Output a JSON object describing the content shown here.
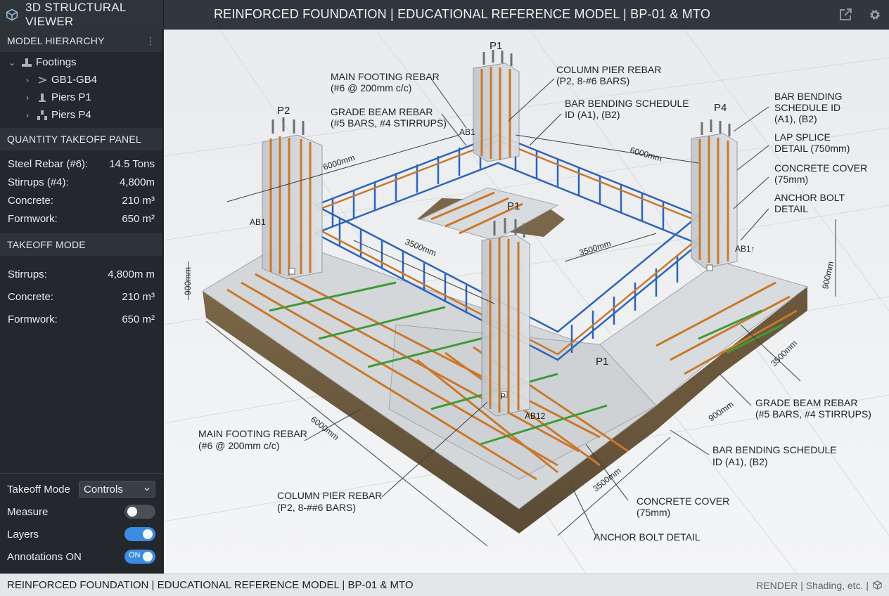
{
  "app": {
    "name": "3D STRUCTURAL VIEWER",
    "document_title": "REINFORCED FOUNDATION | EDUCATIONAL REFERENCE MODEL | BP-01 & MTO"
  },
  "hierarchy": {
    "header": "MODEL HIERARCHY",
    "items": [
      {
        "label": "Footings",
        "expanded": true
      },
      {
        "label": "GB1-GB4"
      },
      {
        "label": "Piers P1"
      },
      {
        "label": "Piers P4"
      }
    ]
  },
  "quantity_panel": {
    "header": "QUANTITY TAKEOFF PANEL",
    "rows": [
      {
        "label": "Steel Rebar (#6):",
        "value": "14.5 Tons"
      },
      {
        "label": "Stirrups (#4):",
        "value": "4,800m"
      },
      {
        "label": "Concrete:",
        "value": "210 m³"
      },
      {
        "label": "Formwork:",
        "value": "650 m²"
      }
    ]
  },
  "takeoff_mode": {
    "header": "TAKEOFF MODE",
    "rows": [
      {
        "label": "Stirrups:",
        "value": "4,800m m"
      },
      {
        "label": "Concrete:",
        "value": "210 m³"
      },
      {
        "label": "Formwork:",
        "value": "650 m²"
      }
    ]
  },
  "controls": {
    "takeoff_mode_label": "Takeoff Mode",
    "takeoff_mode_value": "Controls",
    "measure_label": "Measure",
    "measure_on": false,
    "layers_label": "Layers",
    "layers_on": true,
    "annotations_label": "Annotations ON",
    "annotations_on": true,
    "annotations_toggle_text": "ON"
  },
  "viewport": {
    "pier_labels": {
      "p2": "P2",
      "p1_back": "P1",
      "p4": "P4",
      "p1_center": "P1",
      "p1_front": "P1"
    },
    "anchor_labels": {
      "ab1_left": "AB1",
      "ab1_top": "AB1",
      "ab11": "AB1↑",
      "ab12": "AB12",
      "p_tag": "P"
    },
    "dimensions": {
      "d_top_left": "6000mm",
      "d_top_right": "6000mm",
      "d_inner_left": "3500mm",
      "d_inner_right": "3500mm",
      "d_left_h": "900mm",
      "d_right_h": "900mm",
      "d_right_depth": "3500mm",
      "d_right_900": "900mm",
      "d_front_long": "6000mm",
      "d_front_short": "3500mm"
    },
    "callouts": {
      "main_footing_top_1": "MAIN FOOTING REBAR",
      "main_footing_top_2": "(#6 @ 200mm c/c)",
      "grade_beam_top_1": "GRADE BEAM REBAR",
      "grade_beam_top_2": "(#5 BARS, #4 STIRRUPS)",
      "column_pier_top_1": "COLUMN PIER REBAR",
      "column_pier_top_2": "(P2, 8-#6 BARS)",
      "bbs_top_1": "BAR BENDING SCHEDULE",
      "bbs_top_2": "ID (A1), (B2)",
      "bbs_right_1": "BAR BENDING",
      "bbs_right_2": "SCHEDULE ID",
      "bbs_right_3": "(A1), (B2)",
      "lap_1": "LAP SPLICE",
      "lap_2": "DETAIL (750mm)",
      "cover_right_1": "CONCRETE COVER",
      "cover_right_2": "(75mm)",
      "anchor_right_1": "ANCHOR BOLT",
      "anchor_right_2": "DETAIL",
      "grade_beam_bottom_1": "GRADE BEAM REBAR",
      "grade_beam_bottom_2": "(#5 BARS, #4 STIRRUPS)",
      "bbs_bottom_1": "BAR BENDING SCHEDULE",
      "bbs_bottom_2": "ID (A1), (B2)",
      "cover_bottom_1": "CONCRETE COVER",
      "cover_bottom_2": "(75mm)",
      "anchor_bottom": "ANCHOR BOLT DETAIL",
      "column_pier_bottom_1": "COLUMN PIER REBAR",
      "column_pier_bottom_2": "(P2, 8-##6 BARS)",
      "main_footing_bottom_1": "MAIN FOOTING REBAR",
      "main_footing_bottom_2": "(#6 @ 200mm c/c)"
    }
  },
  "statusbar": {
    "left": "REINFORCED FOUNDATION | EDUCATIONAL REFERENCE MODEL | BP-01 & MTO",
    "right": "RENDER | Shading, etc. |"
  },
  "colors": {
    "rebar_orange": "#c9782c",
    "rebar_blue": "#2f64b8",
    "rebar_green": "#3f9a3a",
    "concrete": "#c9ccd0",
    "soil": "#6e5a40",
    "toggle_on": "#3a8de0"
  }
}
